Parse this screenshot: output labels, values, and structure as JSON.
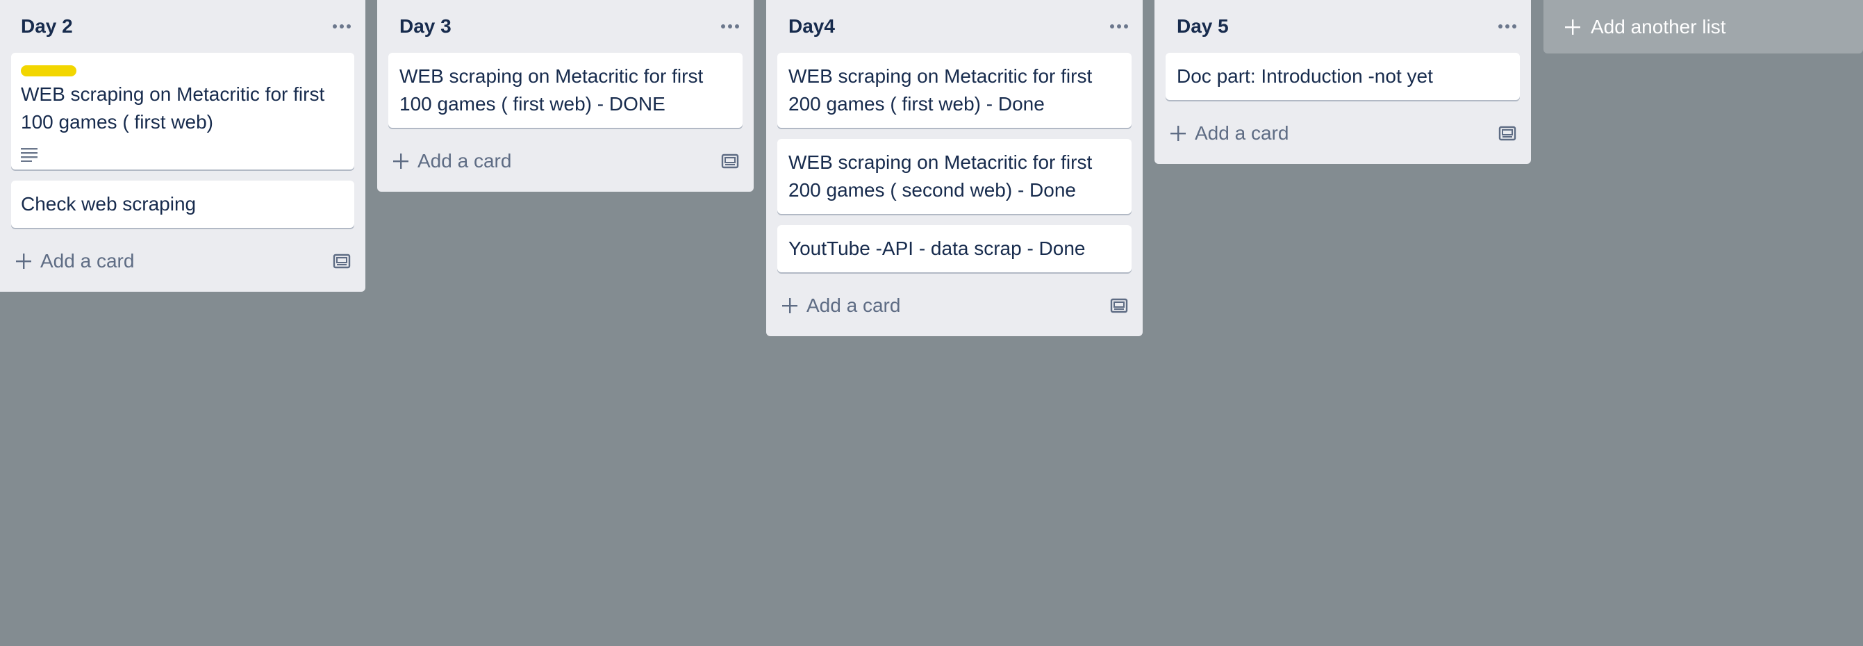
{
  "lists": [
    {
      "title": "Day 2",
      "cards": [
        {
          "label_color": "#f2d600",
          "text": "WEB scraping on Metacritic for first 100 games   ( first web)",
          "has_description": true
        },
        {
          "text": "Check web scraping"
        }
      ],
      "add_card": "Add a card"
    },
    {
      "title": "Day 3",
      "cards": [
        {
          "text": "WEB scraping on Metacritic for first 100 games   ( first web) - DONE"
        }
      ],
      "add_card": "Add a card"
    },
    {
      "title": "Day4",
      "cards": [
        {
          "text": "WEB scraping on Metacritic for first 200 games ( first web) - Done"
        },
        {
          "text": "WEB scraping on Metacritic for first 200 games ( second web) - Done"
        },
        {
          "text": "YoutTube -API - data scrap - Done"
        }
      ],
      "add_card": "Add a card"
    },
    {
      "title": "Day 5",
      "cards": [
        {
          "text": "Doc part: Introduction -not yet"
        }
      ],
      "add_card": "Add a card"
    }
  ],
  "add_list": "Add another list",
  "icons": {
    "list_menu": "more-horizontal-icon",
    "add": "plus-icon",
    "template": "card-template-icon",
    "description": "description-icon"
  },
  "colors": {
    "board_background": "#838c91",
    "list_background": "#ebecf0",
    "label_yellow": "#f2d600"
  }
}
